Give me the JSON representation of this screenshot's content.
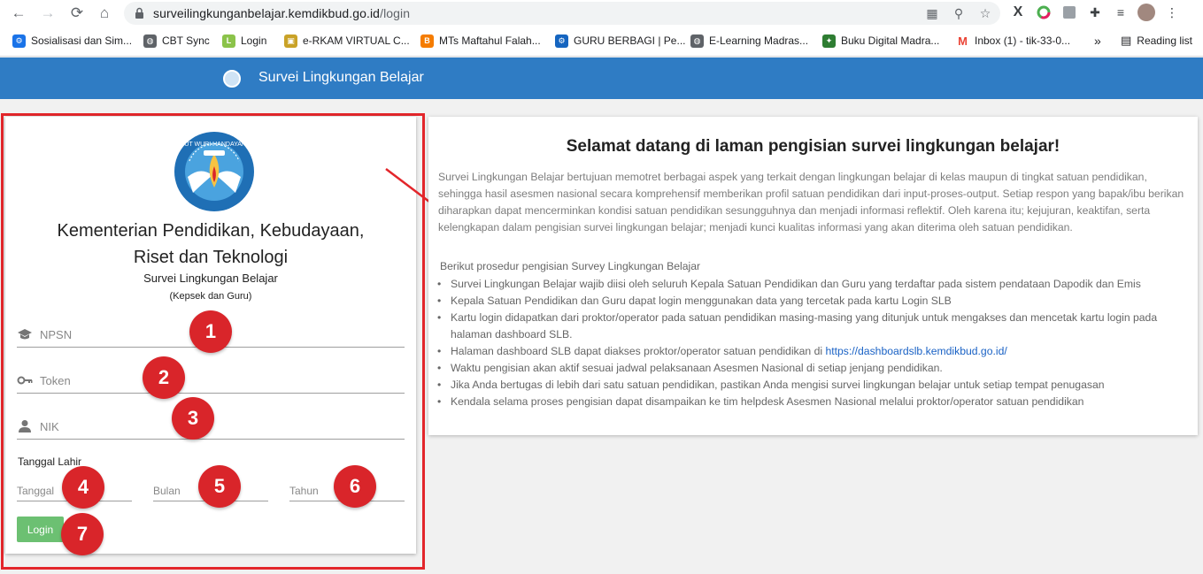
{
  "browser": {
    "url_host": "surveilingkunganbelajar.kemdikbud.go.id",
    "url_path": "/login",
    "reading_list": "Reading list",
    "more_bookmarks": "»"
  },
  "bookmarks": [
    {
      "label": "Sosialisasi dan Sim...",
      "color": "#1a73e8",
      "glyph": "⚙"
    },
    {
      "label": "CBT Sync",
      "color": "#5f6368",
      "glyph": "◍"
    },
    {
      "label": "Login",
      "color": "#8bc34a",
      "glyph": "L"
    },
    {
      "label": "e-RKAM VIRTUAL C...",
      "color": "#c9a227",
      "glyph": "▣"
    },
    {
      "label": "MTs Maftahul Falah...",
      "color": "#f57c00",
      "glyph": "B"
    },
    {
      "label": "GURU BERBAGI | Pe...",
      "color": "#1565c0",
      "glyph": "⚙"
    },
    {
      "label": "E-Learning Madras...",
      "color": "#5f6368",
      "glyph": "◍"
    },
    {
      "label": "Buku Digital Madra...",
      "color": "#2e7d32",
      "glyph": "✦"
    },
    {
      "label": "Inbox (1) - tik-33-0...",
      "color": "#ea4335",
      "glyph": "M"
    }
  ],
  "appbar": {
    "title": "Survei Lingkungan Belajar"
  },
  "login": {
    "ministry_line1": "Kementerian Pendidikan, Kebudayaan,",
    "ministry_line2": "Riset dan Teknologi",
    "subtitle": "Survei Lingkungan Belajar",
    "audience": "(Kepsek dan Guru)",
    "fields": {
      "npsn": "NPSN",
      "token": "Token",
      "nik": "NIK"
    },
    "dob_label": "Tanggal Lahir",
    "dob": {
      "day": "Tanggal",
      "month": "Bulan",
      "year": "Tahun"
    },
    "button": "Login",
    "emblem_text": "TUT WURI HANDAYANI"
  },
  "badges": [
    "1",
    "2",
    "3",
    "4",
    "5",
    "6",
    "7"
  ],
  "info": {
    "title": "Selamat datang di laman pengisian survei lingkungan belajar!",
    "intro": "Survei Lingkungan Belajar bertujuan memotret berbagai aspek yang terkait dengan lingkungan belajar di kelas maupun di tingkat satuan pendidikan, sehingga hasil asesmen nasional secara komprehensif memberikan profil satuan pendidikan dari input-proses-output. Setiap respon yang bapak/ibu berikan diharapkan dapat mencerminkan kondisi satuan pendidikan sesungguhnya dan menjadi informasi reflektif. Oleh karena itu; kejujuran, keaktifan, serta kelengkapan dalam pengisian survei lingkungan belajar; menjadi kunci kualitas informasi yang akan diterima oleh satuan pendidikan.",
    "procedure_title": "Berikut prosedur pengisian Survey Lingkungan Belajar",
    "procedure": [
      "Survei Lingkungan Belajar wajib diisi oleh seluruh Kepala Satuan Pendidikan dan Guru yang terdaftar pada sistem pendataan Dapodik dan Emis",
      "Kepala Satuan Pendidikan dan Guru dapat login menggunakan data yang tercetak pada kartu Login SLB",
      "Kartu login didapatkan dari proktor/operator pada satuan pendidikan masing-masing yang ditunjuk untuk mengakses dan mencetak kartu login pada halaman dashboard SLB.",
      "Halaman dashboard SLB dapat diakses proktor/operator satuan pendidikan di ",
      "Waktu pengisian akan aktif sesuai jadwal pelaksanaan Asesmen Nasional di setiap jenjang pendidikan.",
      "Jika Anda bertugas di lebih dari satu satuan pendidikan, pastikan Anda mengisi survei lingkungan belajar untuk setiap tempat penugasan",
      "Kendala selama proses pengisian dapat disampaikan ke tim helpdesk Asesmen Nasional melalui proktor/operator satuan pendidikan"
    ],
    "dashboard_link": "https://dashboardslb.kemdikbud.go.id/"
  },
  "colors": {
    "appbar": "#2f7cc4",
    "badge": "#d9252a",
    "login_button": "#6cc072",
    "link": "#1a62c5"
  }
}
